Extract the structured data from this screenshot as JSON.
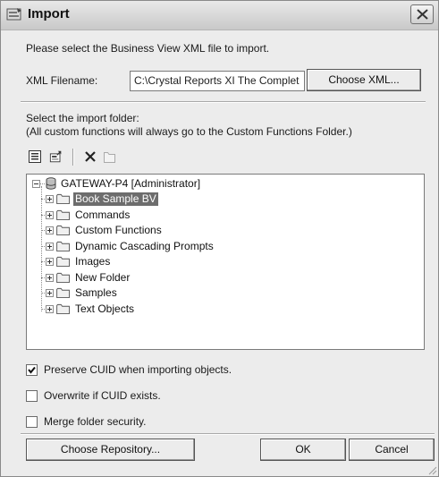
{
  "window": {
    "title": "Import"
  },
  "prompt_text": "Please select the Business View XML file to import.",
  "xml": {
    "label": "XML Filename:",
    "value": "C:\\Crystal Reports XI The Complet",
    "choose_button": "Choose XML..."
  },
  "folder_prompt": {
    "line1": "Select the import folder:",
    "line2": "(All custom functions will always go to the Custom Functions Folder.)"
  },
  "toolbar": [
    "properties-icon",
    "new-folder-icon",
    "delete-icon",
    "folder-up-icon"
  ],
  "tree": {
    "root": "GATEWAY-P4 [Administrator]",
    "items": [
      {
        "label": "Book Sample BV",
        "selected": true
      },
      {
        "label": "Commands"
      },
      {
        "label": "Custom Functions"
      },
      {
        "label": "Dynamic Cascading Prompts"
      },
      {
        "label": "Images"
      },
      {
        "label": "New Folder"
      },
      {
        "label": "Samples"
      },
      {
        "label": "Text Objects"
      }
    ]
  },
  "options": [
    {
      "label": "Preserve CUID when importing objects.",
      "checked": true
    },
    {
      "label": "Overwrite if CUID exists.",
      "checked": false
    },
    {
      "label": "Merge folder security.",
      "checked": false
    }
  ],
  "buttons": {
    "repository": "Choose Repository...",
    "ok": "OK",
    "cancel": "Cancel"
  }
}
